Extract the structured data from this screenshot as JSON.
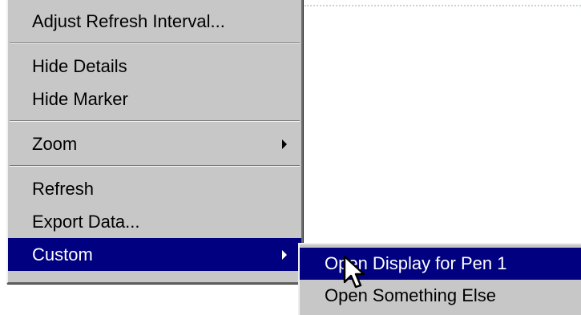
{
  "context_menu": {
    "groups": [
      {
        "items": [
          {
            "label": "Adjust Refresh Interval..."
          }
        ]
      },
      {
        "items": [
          {
            "label": "Hide Details"
          },
          {
            "label": "Hide Marker"
          }
        ]
      },
      {
        "items": [
          {
            "label": "Zoom",
            "has_submenu": true
          }
        ]
      },
      {
        "items": [
          {
            "label": "Refresh"
          },
          {
            "label": "Export Data..."
          },
          {
            "label": "Custom",
            "has_submenu": true,
            "highlighted": true
          }
        ]
      }
    ]
  },
  "custom_submenu": {
    "items": [
      {
        "label": "Open Display for Pen 1",
        "highlighted": true
      },
      {
        "label": "Open Something Else"
      }
    ]
  },
  "cursor": {
    "icon": "arrow-pointer-icon"
  },
  "colors": {
    "menu_background": "#c7c7c7",
    "highlight_background": "#000080",
    "highlight_text": "#ffffff"
  }
}
